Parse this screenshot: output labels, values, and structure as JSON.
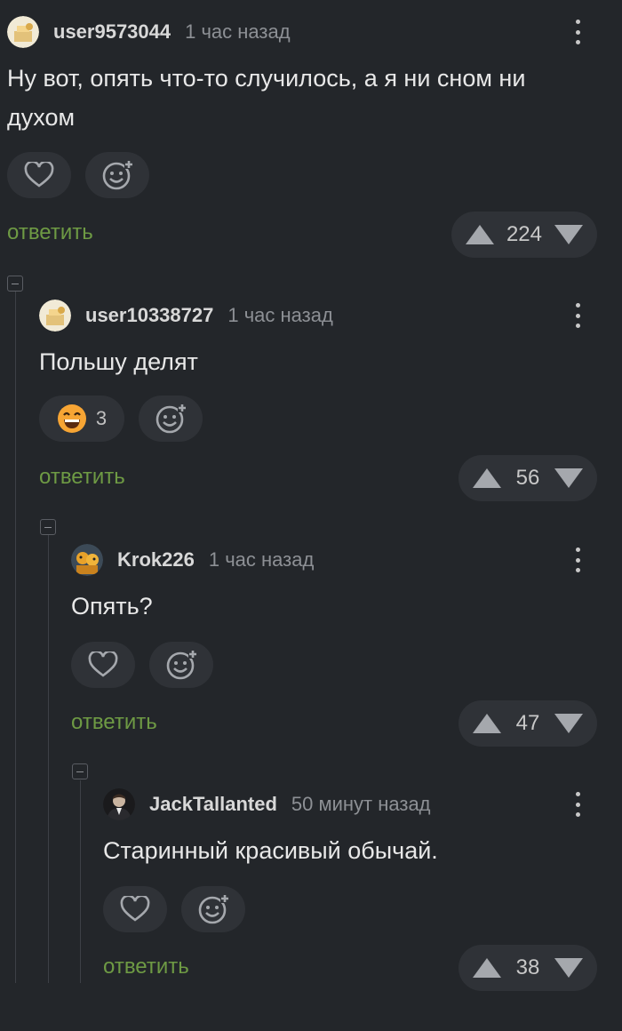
{
  "comments": [
    {
      "username": "user9573044",
      "time": "1 час назад",
      "text": "Ну вот, опять что-то случилось, а я ни сном ни духом",
      "reactions": [],
      "reply_label": "ответить",
      "score": "224"
    },
    {
      "username": "user10338727",
      "time": "1 час назад",
      "text": "Польшу делят",
      "reactions": [
        {
          "emoji": "grinning-face",
          "count": "3"
        }
      ],
      "reply_label": "ответить",
      "score": "56"
    },
    {
      "username": "Krok226",
      "time": "1 час назад",
      "text": "Опять?",
      "reactions": [],
      "reply_label": "ответить",
      "score": "47"
    },
    {
      "username": "JackTallanted",
      "time": "50 минут назад",
      "text": "Старинный красивый обычай.",
      "reactions": [],
      "reply_label": "ответить",
      "score": "38"
    }
  ],
  "colors": {
    "background": "#23262a",
    "pill": "#2f3237",
    "reply": "#6e9a44",
    "muted": "#8d9095",
    "icon": "#a5a8ad"
  },
  "icons": {
    "like": "heart-icon",
    "add_reaction": "add-emoji-icon",
    "upvote": "triangle-up-icon",
    "downvote": "triangle-down-icon",
    "more": "more-vertical-icon",
    "collapse": "minus-square-icon"
  }
}
